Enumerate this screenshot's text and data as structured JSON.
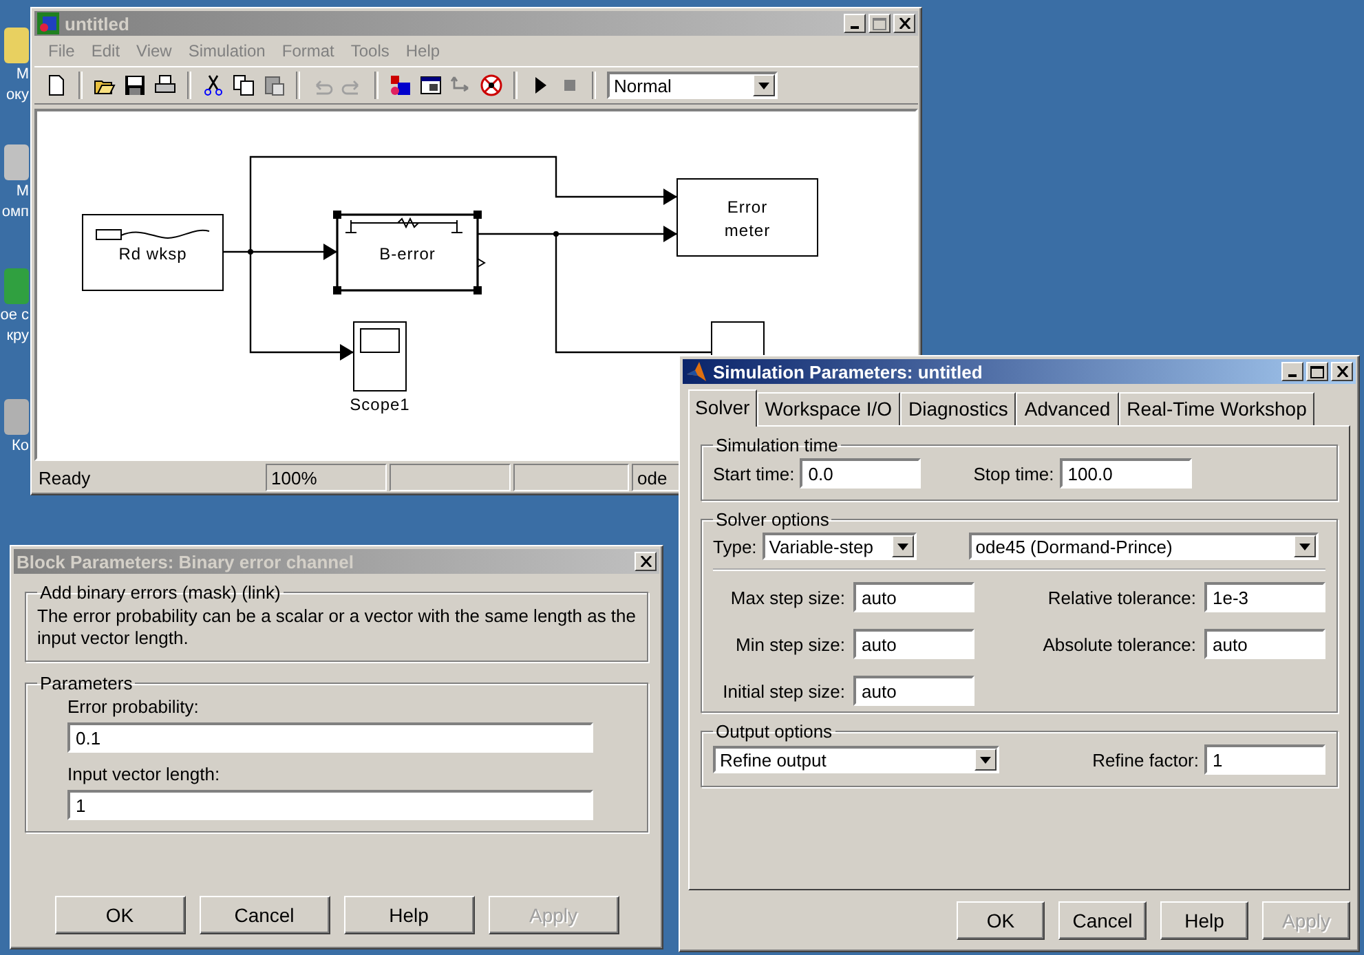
{
  "desktop": {
    "icons": [
      {
        "lines": [
          "М",
          "оку"
        ]
      },
      {
        "lines": [
          "М",
          "омп"
        ]
      },
      {
        "lines": [
          "ое с",
          "кру"
        ]
      },
      {
        "lines": [
          "Ко"
        ]
      }
    ]
  },
  "model_window": {
    "title": "untitled",
    "active": false,
    "menu": [
      "File",
      "Edit",
      "View",
      "Simulation",
      "Format",
      "Tools",
      "Help"
    ],
    "mode": "Normal",
    "blocks": [
      {
        "lines": [
          "Rd wksp"
        ],
        "selected": false
      },
      {
        "lines": [
          "B-error"
        ],
        "selected": true
      },
      {
        "lines": [
          "Error",
          "meter"
        ],
        "selected": false
      },
      {
        "lines": [
          "Scope1"
        ],
        "selected": false
      }
    ],
    "status_bar": {
      "state": "Ready",
      "zoom": "100%",
      "solver": "ode"
    }
  },
  "block_parameters": {
    "title": "Block Parameters: Binary error channel",
    "active": false,
    "mask": {
      "title": "Add binary errors (mask) (link)",
      "description": "The error probability can be a scalar or a vector with the same length as the input vector length."
    },
    "parameters": {
      "title": "Parameters",
      "fields": [
        {
          "label": "Error probability:",
          "value": "0.1"
        },
        {
          "label": "Input vector length:",
          "value": "1"
        }
      ]
    },
    "buttons": [
      {
        "label": "OK",
        "disabled": false
      },
      {
        "label": "Cancel",
        "disabled": false
      },
      {
        "label": "Help",
        "disabled": false
      },
      {
        "label": "Apply",
        "disabled": true
      }
    ]
  },
  "simulation_parameters": {
    "title": "Simulation Parameters: untitled",
    "active": true,
    "tabs": [
      {
        "label": "Solver",
        "selected": true
      },
      {
        "label": "Workspace I/O",
        "selected": false
      },
      {
        "label": "Diagnostics",
        "selected": false
      },
      {
        "label": "Advanced",
        "selected": false
      },
      {
        "label": "Real-Time Workshop",
        "selected": false
      }
    ],
    "simulation_time": {
      "title": "Simulation time",
      "start_label": "Start time:",
      "start_value": "0.0",
      "stop_label": "Stop time:",
      "stop_value": "100.0"
    },
    "solver_options": {
      "title": "Solver options",
      "type_label": "Type:",
      "type": "Variable-step",
      "solver": "ode45 (Dormand-Prince)",
      "left_fields": [
        {
          "label": "Max step size:",
          "value": "auto"
        },
        {
          "label": "Min step size:",
          "value": "auto"
        },
        {
          "label": "Initial step size:",
          "value": "auto"
        }
      ],
      "right_fields": [
        {
          "label": "Relative tolerance:",
          "value": "1e-3"
        },
        {
          "label": "Absolute tolerance:",
          "value": "auto"
        }
      ]
    },
    "output_options": {
      "title": "Output options",
      "option": "Refine output",
      "factor_label": "Refine factor:",
      "factor_value": "1"
    },
    "buttons": [
      {
        "label": "OK",
        "disabled": false
      },
      {
        "label": "Cancel",
        "disabled": false
      },
      {
        "label": "Help",
        "disabled": false
      },
      {
        "label": "Apply",
        "disabled": true
      }
    ]
  }
}
